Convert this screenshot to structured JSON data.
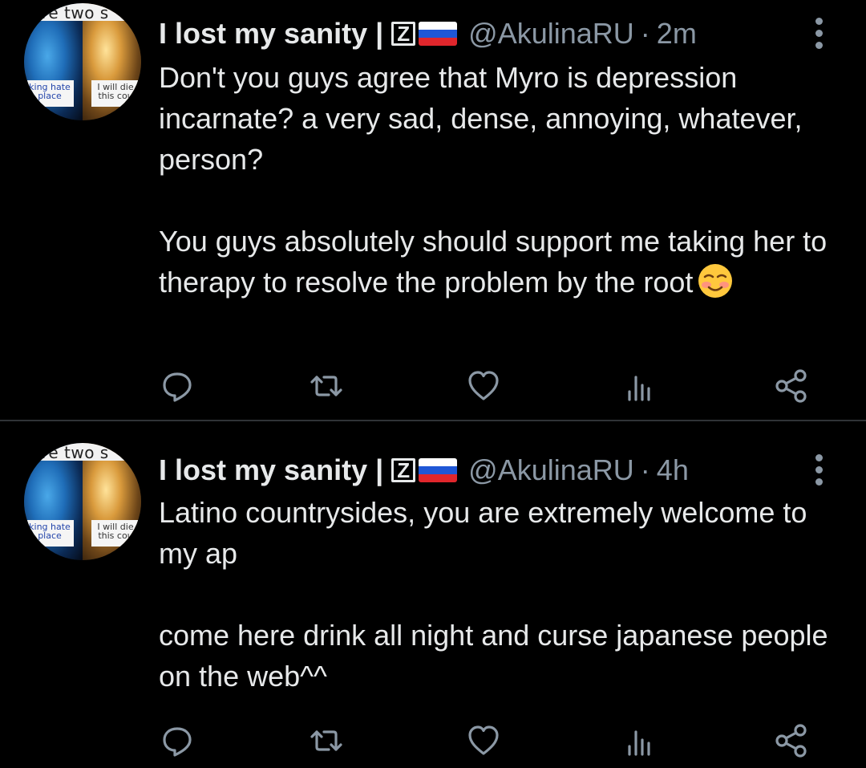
{
  "tweets": [
    {
      "avatar": {
        "top_text": "ve two s",
        "caption_left": "king hate place",
        "caption_right": "I will die this cou"
      },
      "display_name": "I lost my sanity |",
      "badge": "Z",
      "handle": "@AkulinaRU",
      "separator": "·",
      "time": "2m",
      "paragraphs": [
        "Don't you guys agree that Myro is depression incarnate? a very sad, dense, annoying, whatever, person?",
        "You guys absolutely should support me taking her to therapy to resolve the problem by the root"
      ],
      "emoji": "smiling-face-with-blush"
    },
    {
      "avatar": {
        "top_text": "ve two s",
        "caption_left": "king hate place",
        "caption_right": "I will die this cou"
      },
      "display_name": "I lost my sanity |",
      "badge": "Z",
      "handle": "@AkulinaRU",
      "separator": "·",
      "time": "4h",
      "paragraphs": [
        "Latino countrysides, you are extremely welcome to my ap",
        "come here drink all night and curse japanese people on the web^^"
      ]
    }
  ],
  "icons": {
    "reply": "reply-icon",
    "retweet": "retweet-icon",
    "like": "like-icon",
    "views": "views-icon",
    "share": "share-icon",
    "more": "more-icon"
  },
  "colors": {
    "background": "#000000",
    "text": "#e7e9ea",
    "secondary": "#8b98a5",
    "divider": "#2f3336"
  }
}
